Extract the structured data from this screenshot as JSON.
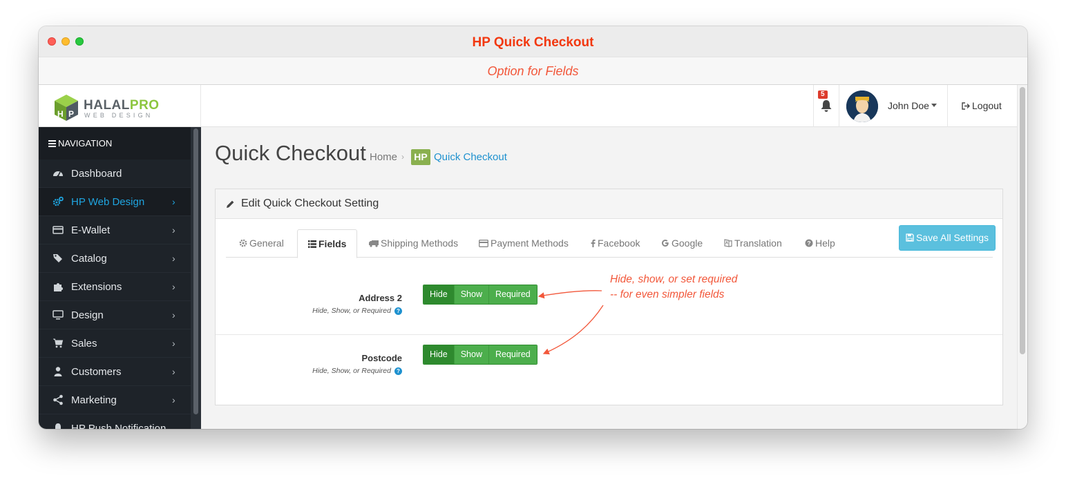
{
  "window": {
    "title": "HP Quick Checkout",
    "subtitle": "Option for Fields"
  },
  "logo": {
    "brand_a": "HALAL",
    "brand_b": "PRO",
    "tagline": "WEB DESIGN"
  },
  "header": {
    "notifications_count": "5",
    "user_name": "John Doe",
    "logout_label": "Logout"
  },
  "sidebar": {
    "header": "NAVIGATION",
    "items": [
      {
        "label": "Dashboard",
        "icon": "dashboard-icon"
      },
      {
        "label": "HP Web Design",
        "icon": "cogs-icon",
        "active": true
      },
      {
        "label": "E-Wallet",
        "icon": "credit-card-icon"
      },
      {
        "label": "Catalog",
        "icon": "tags-icon"
      },
      {
        "label": "Extensions",
        "icon": "puzzle-icon"
      },
      {
        "label": "Design",
        "icon": "monitor-icon"
      },
      {
        "label": "Sales",
        "icon": "cart-icon"
      },
      {
        "label": "Customers",
        "icon": "user-icon"
      },
      {
        "label": "Marketing",
        "icon": "share-icon"
      },
      {
        "label": "HP Push Notification",
        "icon": "bell-icon"
      }
    ]
  },
  "page": {
    "title": "Quick Checkout",
    "breadcrumb": {
      "home": "Home",
      "badge": "HP",
      "current": "Quick Checkout"
    }
  },
  "panel": {
    "heading": "Edit Quick Checkout Setting",
    "save_label": "Save All Settings",
    "tabs": [
      {
        "label": "General",
        "icon": "gear-icon"
      },
      {
        "label": "Fields",
        "icon": "list-icon",
        "active": true
      },
      {
        "label": "Shipping Methods",
        "icon": "truck-icon"
      },
      {
        "label": "Payment Methods",
        "icon": "credit-card-icon"
      },
      {
        "label": "Facebook",
        "icon": "facebook-icon"
      },
      {
        "label": "Google",
        "icon": "google-icon"
      },
      {
        "label": "Translation",
        "icon": "translate-icon"
      },
      {
        "label": "Help",
        "icon": "question-icon"
      }
    ],
    "fields": [
      {
        "label": "Address 2",
        "help": "Hide, Show, or Required",
        "options": [
          "Hide",
          "Show",
          "Required"
        ],
        "selected": "Hide"
      },
      {
        "label": "Postcode",
        "help": "Hide, Show, or Required",
        "options": [
          "Hide",
          "Show",
          "Required"
        ],
        "selected": "Hide"
      }
    ]
  },
  "annotation": {
    "line1": "Hide, show, or set required",
    "line2": "-- for even simpler fields"
  },
  "colors": {
    "accent": "#1e91cf",
    "annotation": "#f2573a",
    "toggle_green": "#4cae4c",
    "toggle_active": "#2e8a2e",
    "sidebar": "#1e2329"
  }
}
